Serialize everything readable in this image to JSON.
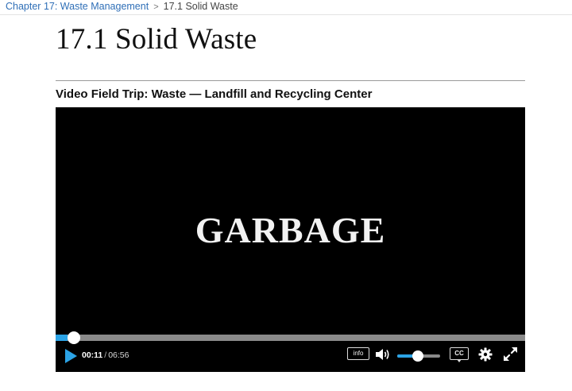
{
  "breadcrumb": {
    "parent": "Chapter 17: Waste Management",
    "separator": ">",
    "current": "17.1 Solid Waste"
  },
  "page": {
    "title": "17.1 Solid Waste",
    "video_heading": "Video Field Trip: Waste — Landfill and Recycling Center"
  },
  "player": {
    "frame_text": "GARBAGE",
    "time_current": "00:11",
    "time_separator": "/",
    "time_total": "06:56",
    "progress_fraction": 0.026,
    "volume_fraction": 0.48,
    "info_label": "info",
    "cc_label": "CC",
    "accent_color": "#2ba3e6",
    "icons": [
      "play-icon",
      "volume-icon",
      "settings-gear-icon",
      "fullscreen-icon"
    ]
  },
  "colors": {
    "link": "#2f6fb7",
    "player_background": "#000000"
  }
}
